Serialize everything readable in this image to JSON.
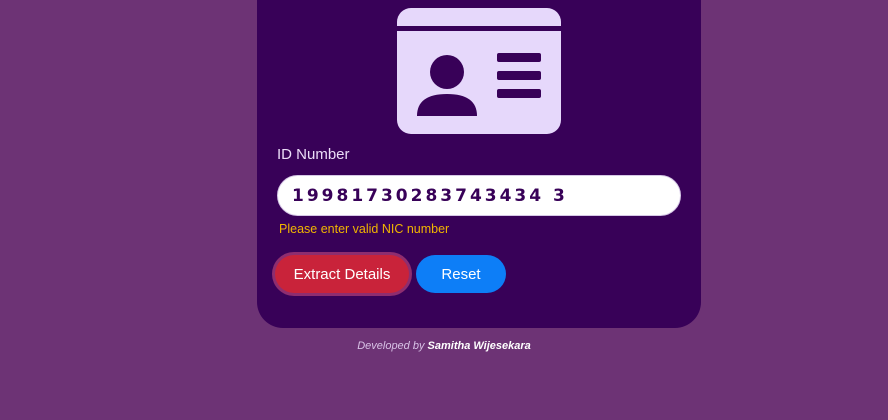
{
  "form": {
    "id_label": "ID Number",
    "id_value": "19981730283743434 3",
    "error_text": "Please enter valid NIC number"
  },
  "buttons": {
    "extract_label": "Extract Details",
    "reset_label": "Reset"
  },
  "footer": {
    "prefix": "Developed by",
    "author": "Samitha Wijesekara"
  },
  "colors": {
    "background": "#6d3375",
    "card": "#380158",
    "icon_fill": "#e6d8fb",
    "error": "#f1b500",
    "extract_button": "#c9233a",
    "reset_button": "#0d7ef7"
  },
  "icons": {
    "id_card": "id-card-icon"
  }
}
